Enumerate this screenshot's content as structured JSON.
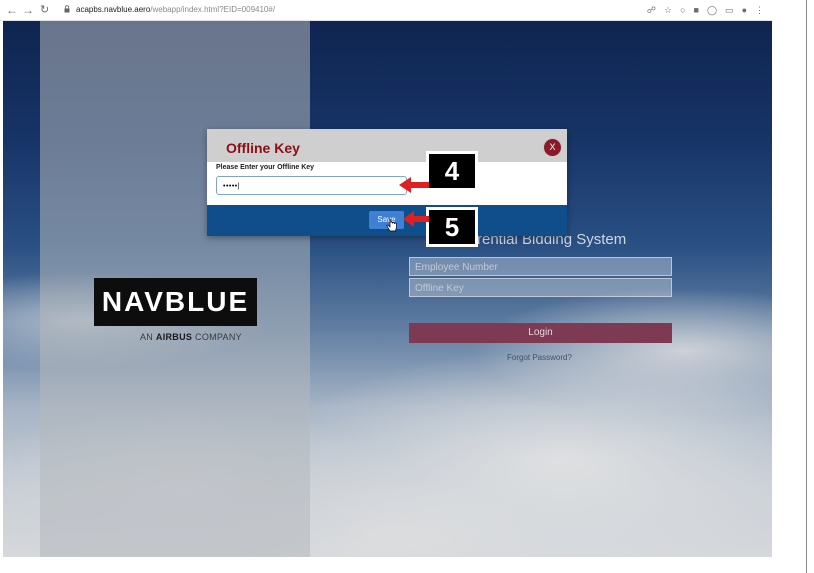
{
  "browser": {
    "url_domain": "acapbs.navblue.aero",
    "url_path": "/webapp/index.html?EID=009410#/",
    "back_icon": "arrow-left-icon",
    "forward_icon": "arrow-right-icon",
    "reload_icon": "reload-icon"
  },
  "brand": {
    "logo": "NAVBLUE",
    "subtitle_prefix": "AN ",
    "subtitle_bold": "AIRBUS",
    "subtitle_suffix": " COMPANY",
    "color": "#0d0d0d"
  },
  "login": {
    "system_title_visible": "rential Bidding System",
    "employee_placeholder": "Employee Number",
    "offline_key_placeholder": "Offline Key",
    "login_label": "Login",
    "forgot_label": "Forgot Password?",
    "login_color": "#7d3a52"
  },
  "modal": {
    "title": "Offline Key",
    "close_label": "X",
    "prompt": "Please Enter your Offline Key",
    "input_value": "•••••|",
    "save_label": "Save",
    "title_color": "#8b0f18",
    "footer_color": "#0f4d8b"
  },
  "callouts": [
    {
      "label": "4",
      "color": "#e02020"
    },
    {
      "label": "5",
      "color": "#e02020"
    }
  ]
}
